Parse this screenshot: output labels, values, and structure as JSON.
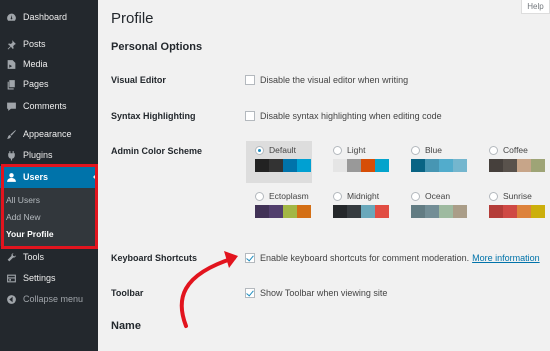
{
  "sidebar": {
    "items": [
      {
        "label": "Dashboard",
        "icon": "dashboard-icon"
      },
      {
        "label": "Posts",
        "icon": "pin-icon"
      },
      {
        "label": "Media",
        "icon": "media-icon"
      },
      {
        "label": "Pages",
        "icon": "pages-icon"
      },
      {
        "label": "Comments",
        "icon": "comments-icon"
      },
      {
        "label": "Appearance",
        "icon": "brush-icon"
      },
      {
        "label": "Plugins",
        "icon": "plug-icon"
      },
      {
        "label": "Users",
        "icon": "user-icon",
        "active": true
      },
      {
        "label": "Tools",
        "icon": "wrench-icon"
      },
      {
        "label": "Settings",
        "icon": "settings-icon"
      },
      {
        "label": "Collapse menu",
        "icon": "collapse-icon"
      }
    ],
    "submenu": [
      {
        "label": "All Users"
      },
      {
        "label": "Add New"
      },
      {
        "label": "Your Profile",
        "current": true
      }
    ],
    "colors": {
      "background": "#23282d",
      "active": "#0073aa",
      "highlight_box": "#e2141e"
    }
  },
  "header": {
    "help_label": "Help"
  },
  "main": {
    "title": "Profile",
    "section_personal": "Personal Options",
    "section_name": "Name",
    "visual_editor": {
      "label": "Visual Editor",
      "checkbox_text": "Disable the visual editor when writing",
      "checked": false
    },
    "syntax_highlighting": {
      "label": "Syntax Highlighting",
      "checkbox_text": "Disable syntax highlighting when editing code",
      "checked": false
    },
    "color_scheme": {
      "label": "Admin Color Scheme",
      "schemes": [
        {
          "name": "Default",
          "selected": true,
          "colors": [
            "#222222",
            "#333333",
            "#0073aa",
            "#00a0d2"
          ]
        },
        {
          "name": "Light",
          "selected": false,
          "colors": [
            "#e5e5e5",
            "#999999",
            "#d64e07",
            "#04a4cc"
          ]
        },
        {
          "name": "Blue",
          "selected": false,
          "colors": [
            "#096484",
            "#4796b3",
            "#52accc",
            "#74b6ce"
          ]
        },
        {
          "name": "Coffee",
          "selected": false,
          "colors": [
            "#46403c",
            "#59524c",
            "#c7a589",
            "#9ea476"
          ]
        },
        {
          "name": "Ectoplasm",
          "selected": false,
          "colors": [
            "#413256",
            "#523f6d",
            "#a3b745",
            "#d46f15"
          ]
        },
        {
          "name": "Midnight",
          "selected": false,
          "colors": [
            "#25282b",
            "#363b3f",
            "#69a8bb",
            "#e14d43"
          ]
        },
        {
          "name": "Ocean",
          "selected": false,
          "colors": [
            "#627c83",
            "#738e96",
            "#9ebaa0",
            "#aa9d88"
          ]
        },
        {
          "name": "Sunrise",
          "selected": false,
          "colors": [
            "#b43c38",
            "#cf4944",
            "#dd823b",
            "#ccaf0b"
          ]
        }
      ]
    },
    "keyboard_shortcuts": {
      "label": "Keyboard Shortcuts",
      "checkbox_text": "Enable keyboard shortcuts for comment moderation.",
      "link_text": "More information",
      "checked": true
    },
    "toolbar": {
      "label": "Toolbar",
      "checkbox_text": "Show Toolbar when viewing site",
      "checked": true
    },
    "annotation_color": "#e2141e"
  }
}
